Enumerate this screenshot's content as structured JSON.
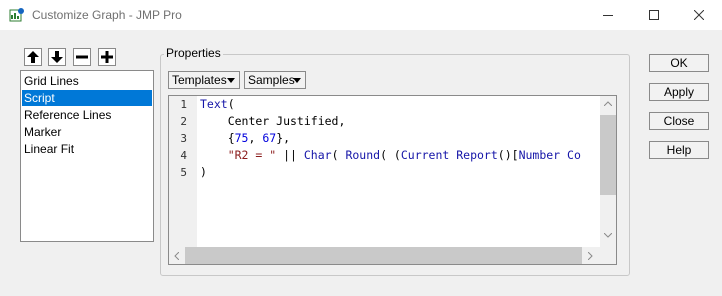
{
  "window": {
    "title": "Customize Graph - JMP Pro",
    "app_icon": "jmp-graph-icon",
    "controls": [
      "minimize-icon",
      "maximize-icon",
      "close-icon"
    ]
  },
  "toolbar": {
    "buttons": [
      "arrow-up-icon",
      "arrow-down-icon",
      "minus-icon",
      "plus-icon"
    ]
  },
  "list": {
    "items": [
      {
        "label": "Grid Lines",
        "selected": false
      },
      {
        "label": "Script",
        "selected": true
      },
      {
        "label": "Reference Lines",
        "selected": false
      },
      {
        "label": "Marker",
        "selected": false
      },
      {
        "label": "Linear Fit",
        "selected": false
      }
    ]
  },
  "properties": {
    "group_label": "Properties",
    "templates_label": "Templates",
    "samples_label": "Samples",
    "script_lines": [
      {
        "number": "1",
        "text": "Text("
      },
      {
        "number": "2",
        "text": "    Center Justified,"
      },
      {
        "number": "3",
        "text": "    {75, 67},"
      },
      {
        "number": "4",
        "text": "    \"R2 = \" || Char( Round( (Current Report()[Number Co"
      },
      {
        "number": "5",
        "text": ")"
      }
    ]
  },
  "buttons": {
    "ok": "OK",
    "apply": "Apply",
    "close": "Close",
    "help": "Help"
  },
  "colors": {
    "selection": "#0078d7",
    "keyword": "#1515a8",
    "number": "#0000dd",
    "string": "#8b1c1c"
  }
}
